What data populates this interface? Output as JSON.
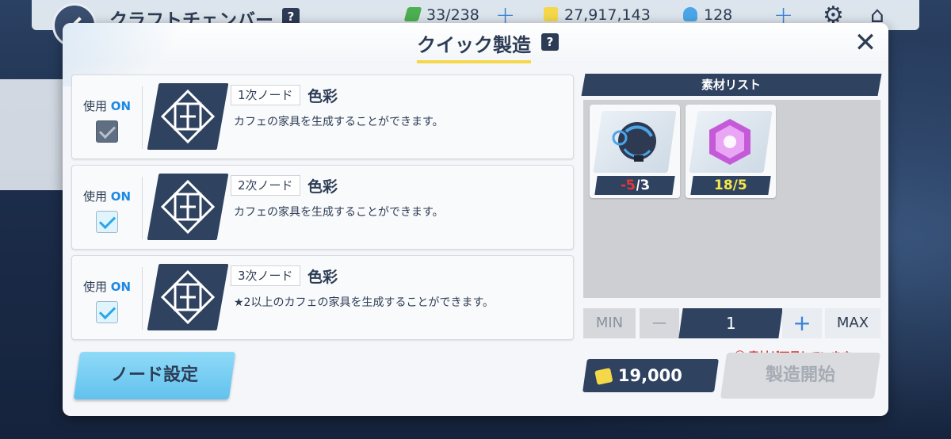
{
  "background": {
    "title": "クラフトチェンバー",
    "help": "?",
    "resources": [
      {
        "icon": "ap-lightning-icon",
        "value": "33/238"
      },
      {
        "icon": "credit-icon",
        "value": "27,917,143"
      },
      {
        "icon": "pyroxene-icon",
        "value": "128"
      }
    ]
  },
  "modal": {
    "title": "クイック製造",
    "help": "?",
    "close": "✕"
  },
  "nodes": [
    {
      "use_label": "使用",
      "use_state": "ON",
      "checked": true,
      "disabled": true,
      "tier": "1次ノード",
      "color": "色彩",
      "description": "カフェの家具を生成することができます。"
    },
    {
      "use_label": "使用",
      "use_state": "ON",
      "checked": true,
      "disabled": false,
      "tier": "2次ノード",
      "color": "色彩",
      "description": "カフェの家具を生成することができます。"
    },
    {
      "use_label": "使用",
      "use_state": "ON",
      "checked": true,
      "disabled": false,
      "tier": "3次ノード",
      "color": "色彩",
      "description": "★2以上のカフェの家具を生成することができます。"
    }
  ],
  "node_settings_button": "ノード設定",
  "materials": {
    "header": "素材リスト",
    "items": [
      {
        "icon": "tech-orb-icon",
        "have": "-5",
        "need": "/3",
        "have_color": "#e53935"
      },
      {
        "icon": "purple-crystal-icon",
        "count": "18/5",
        "count_color": "#f5e84a"
      }
    ]
  },
  "quantity": {
    "min": "MIN",
    "minus": "—",
    "value": "1",
    "plus": "+",
    "max": "MAX"
  },
  "warning": "⓪ 素材が不足しています。",
  "cost": "19,000",
  "start_button": "製造開始"
}
